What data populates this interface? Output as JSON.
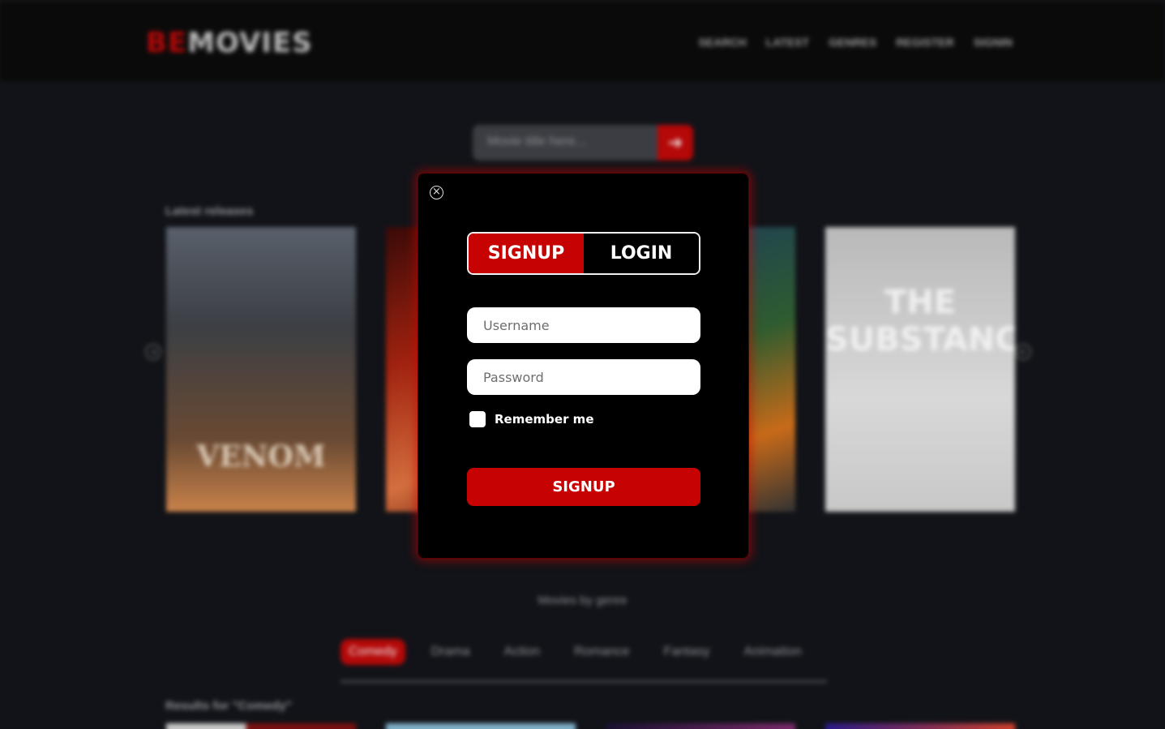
{
  "header": {
    "logo_be": "BE",
    "logo_movies": "MOVIES",
    "nav": [
      "SEARCH",
      "LATEST",
      "GENRES",
      "REGISTER",
      "SIGNIN"
    ]
  },
  "search": {
    "placeholder": "Movie title here..."
  },
  "latest": {
    "title": "Latest releases",
    "posters": [
      "VENOM",
      "THE SUBSTANCE"
    ]
  },
  "genres": {
    "title": "Movies by genre",
    "items": [
      "Comedy",
      "Drama",
      "Action",
      "Romance",
      "Fantasy",
      "Animation"
    ],
    "active": "Comedy",
    "results": "Results for \"Comedy\""
  },
  "modal": {
    "tabs": {
      "signup": "SIGNUP",
      "login": "LOGIN"
    },
    "active_tab": "signup",
    "username_placeholder": "Username",
    "password_placeholder": "Password",
    "remember_label": "Remember me",
    "submit_label": "SIGNUP"
  },
  "colors": {
    "accent": "#c60202",
    "background": "#111318",
    "modal_bg": "#000000"
  }
}
